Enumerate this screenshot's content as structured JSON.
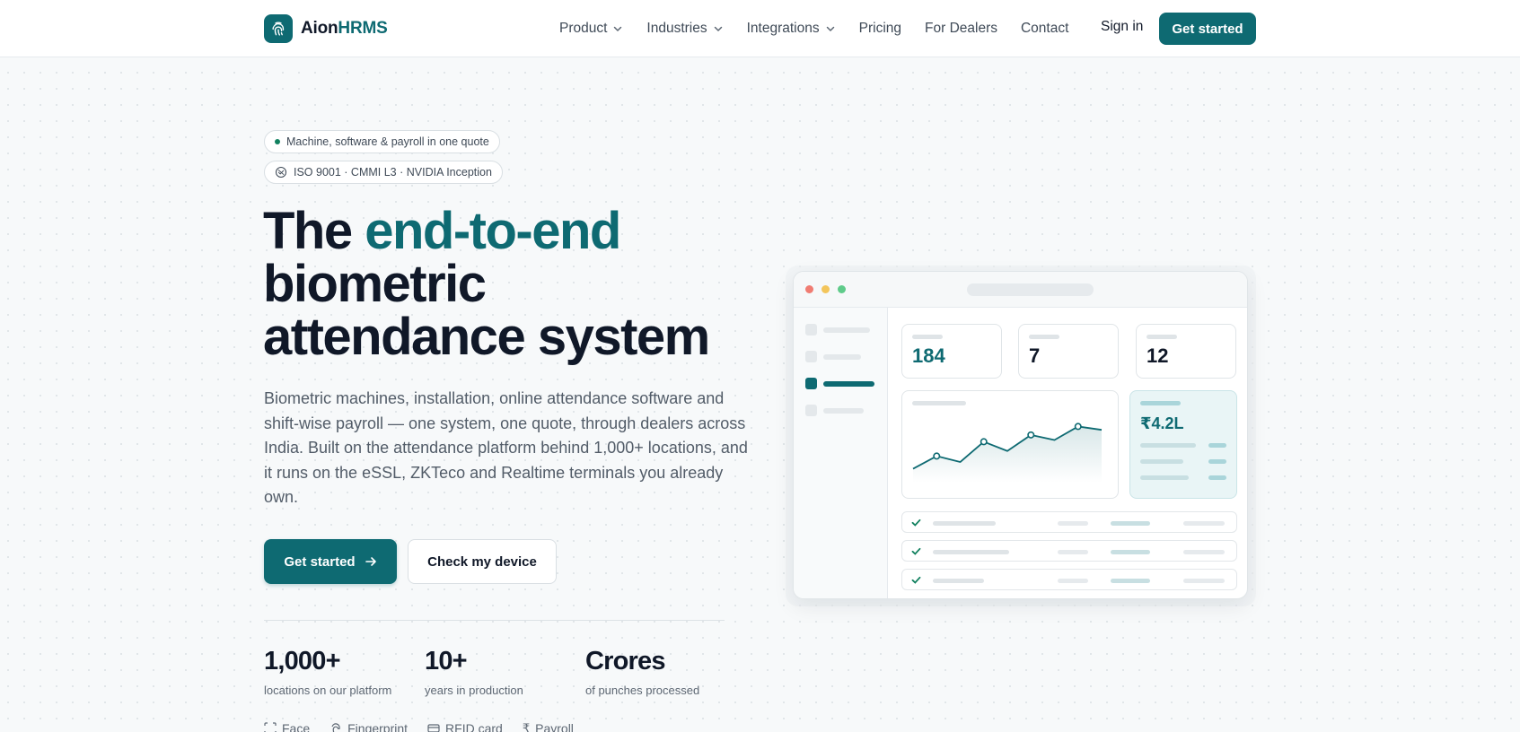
{
  "brand": {
    "name_prefix": "Aion",
    "name_suffix": "HRMS"
  },
  "nav": {
    "items": [
      {
        "label": "Product",
        "has_menu": true
      },
      {
        "label": "Industries",
        "has_menu": true
      },
      {
        "label": "Integrations",
        "has_menu": true
      },
      {
        "label": "Pricing",
        "has_menu": false
      },
      {
        "label": "For Dealers",
        "has_menu": false
      },
      {
        "label": "Contact",
        "has_menu": false
      }
    ],
    "sign_in": "Sign in",
    "cta": "Get started"
  },
  "hero": {
    "pill_1": "Machine, software & payroll in one quote",
    "pill_2": "ISO 9001 · CMMI L3 · NVIDIA Inception",
    "headline_1": "The ",
    "headline_accent": "end-to-end",
    "headline_2": "biometric",
    "headline_3": "attendance system",
    "lede": "Biometric machines, installation, online attendance software and shift-wise payroll — one system, one quote, through dealers across India. Built on the attendance platform behind 1,000+ locations, and it runs on the eSSL, ZKTeco and Realtime terminals you already own.",
    "primary_button": "Get started",
    "secondary_button": "Check my device"
  },
  "stats": [
    {
      "value": "1,000+",
      "label": "locations on our platform"
    },
    {
      "value": "10+",
      "label": "years in production"
    },
    {
      "value": "Crores",
      "label": "of punches processed"
    }
  ],
  "features": [
    {
      "icon": "face-scan-icon",
      "label": "Face"
    },
    {
      "icon": "fingerprint-icon",
      "label": "Fingerprint"
    },
    {
      "icon": "rfid-card-icon",
      "label": "RFID card"
    },
    {
      "icon": "rupee-icon",
      "label": "Payroll"
    }
  ],
  "mockup": {
    "cards": [
      "184",
      "7",
      "12"
    ],
    "amount": "₹4.2L",
    "chart_values": [
      3,
      4.5,
      3.8,
      6.2,
      5.1,
      7,
      6.4,
      8,
      7.6
    ]
  },
  "colors": {
    "brand": "#0e6a72",
    "heading": "#101828",
    "body_text": "#525c68",
    "status_green": "#11815f"
  }
}
